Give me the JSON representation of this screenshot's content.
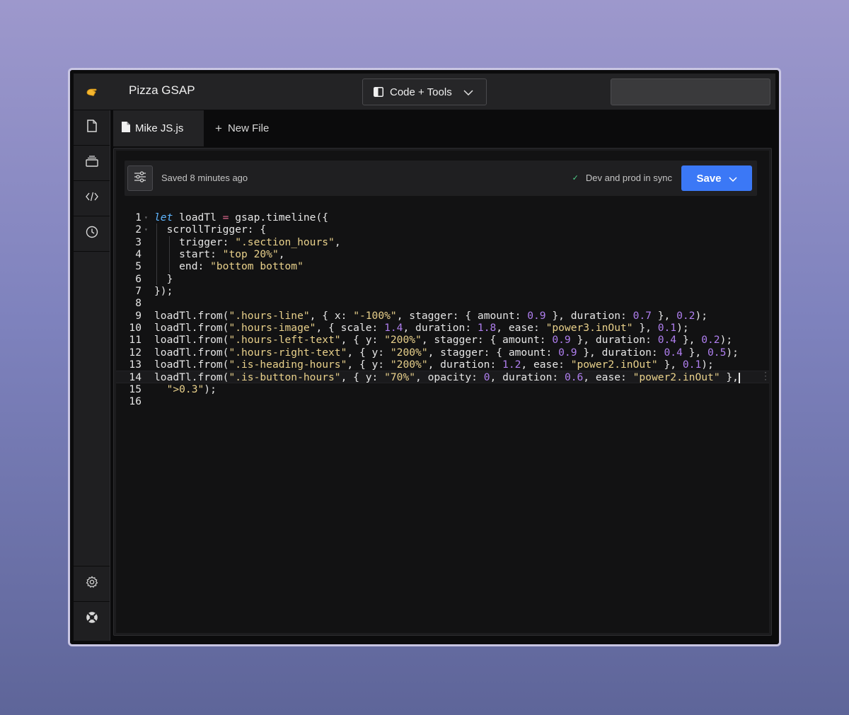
{
  "app": {
    "title": "Pizza GSAP",
    "brand_icon": "hand-wave-icon"
  },
  "header": {
    "mode_label": "Code + Tools",
    "search_value": ""
  },
  "sidebar": {
    "items": [
      {
        "icon": "file-icon"
      },
      {
        "icon": "layers-icon"
      },
      {
        "icon": "code-icon"
      },
      {
        "icon": "history-clock-icon"
      }
    ],
    "bottom_items": [
      {
        "icon": "gear-icon"
      },
      {
        "icon": "help-lifebuoy-icon"
      }
    ]
  },
  "tabs": {
    "active_label": "Mike JS.js",
    "new_file_label": "New File"
  },
  "toolbar": {
    "saved_status": "Saved 8 minutes ago",
    "sync_status": "Dev and prod in sync",
    "save_label": "Save"
  },
  "editor": {
    "current_line": 14,
    "lines": [
      {
        "num": "1",
        "text": "let loadTl = gsap.timeline({"
      },
      {
        "num": "2",
        "text": "  scrollTrigger: {"
      },
      {
        "num": "3",
        "text": "    trigger: \".section_hours\","
      },
      {
        "num": "4",
        "text": "    start: \"top 20%\","
      },
      {
        "num": "5",
        "text": "    end: \"bottom bottom\""
      },
      {
        "num": "6",
        "text": "  }"
      },
      {
        "num": "7",
        "text": "});"
      },
      {
        "num": "8",
        "text": ""
      },
      {
        "num": "9",
        "text": "loadTl.from(\".hours-line\", { x: \"-100%\", stagger: { amount: 0.9 }, duration: 0.7 }, 0.2);"
      },
      {
        "num": "10",
        "text": "loadTl.from(\".hours-image\", { scale: 1.4, duration: 1.8, ease: \"power3.inOut\" }, 0.1);"
      },
      {
        "num": "11",
        "text": "loadTl.from(\".hours-left-text\", { y: \"200%\", stagger: { amount: 0.9 }, duration: 0.4 }, 0.2);"
      },
      {
        "num": "12",
        "text": "loadTl.from(\".hours-right-text\", { y: \"200%\", stagger: { amount: 0.9 }, duration: 0.4 }, 0.5);"
      },
      {
        "num": "13",
        "text": "loadTl.from(\".is-heading-hours\", { y: \"200%\", duration: 1.2, ease: \"power2.inOut\" }, 0.1);"
      },
      {
        "num": "14",
        "text": "loadTl.from(\".is-button-hours\", { y: \"70%\", opacity: 0, duration: 0.6, ease: \"power2.inOut\" },"
      },
      {
        "num": "15",
        "text": "  \">0.3\");"
      },
      {
        "num": "16",
        "text": ""
      }
    ]
  },
  "colors": {
    "accent": "#3b78f6",
    "sync_check": "#4fd08a",
    "keyword": "#5fb6ff",
    "string": "#e9d18b",
    "number": "#b07ff0",
    "operator": "#e26a8f"
  }
}
